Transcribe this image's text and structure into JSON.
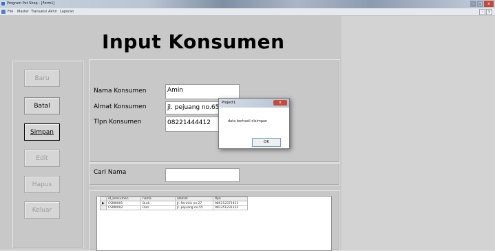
{
  "window": {
    "title": "Program Pet Shop - [Form1]",
    "buttons": [
      "-",
      "□",
      "x"
    ]
  },
  "menu": {
    "items": [
      "File",
      "Master",
      "Transaksi",
      "Akhir",
      "Laporan"
    ],
    "mdi_buttons": [
      "-",
      "x"
    ]
  },
  "form": {
    "title": "Input Konsumen",
    "buttons": [
      {
        "label": "Baru",
        "state": "disabled"
      },
      {
        "label": "Batal",
        "state": "enabled"
      },
      {
        "label": "Simpan",
        "state": "focused"
      },
      {
        "label": "Edit",
        "state": "disabled"
      },
      {
        "label": "Hapus",
        "state": "disabled"
      },
      {
        "label": "Keluar",
        "state": "disabled"
      }
    ],
    "fields": {
      "nama_label": "Nama Konsumen",
      "nama_value": "Amin",
      "alamat_label": "Almat Konsumen",
      "alamat_value": "jl. pejuang no.65",
      "tlpn_label": "Tlpn Konsumen",
      "tlpn_value": "08221444412"
    },
    "search": {
      "label": "Cari Nama",
      "value": ""
    },
    "grid": {
      "columns": [
        "id_konsumen",
        "nama",
        "alamat",
        "tlpn"
      ],
      "rows": [
        [
          "CSM0001",
          "Budi",
          "Jl. Perintis no.27",
          "085212371423"
        ],
        [
          "CSM0002",
          "Didi",
          "Jl. pejuang no.55",
          "081351231232"
        ]
      ]
    }
  },
  "dialog": {
    "title": "Project1",
    "close": "x",
    "message": "data berhasil disimpan",
    "ok": "OK"
  }
}
